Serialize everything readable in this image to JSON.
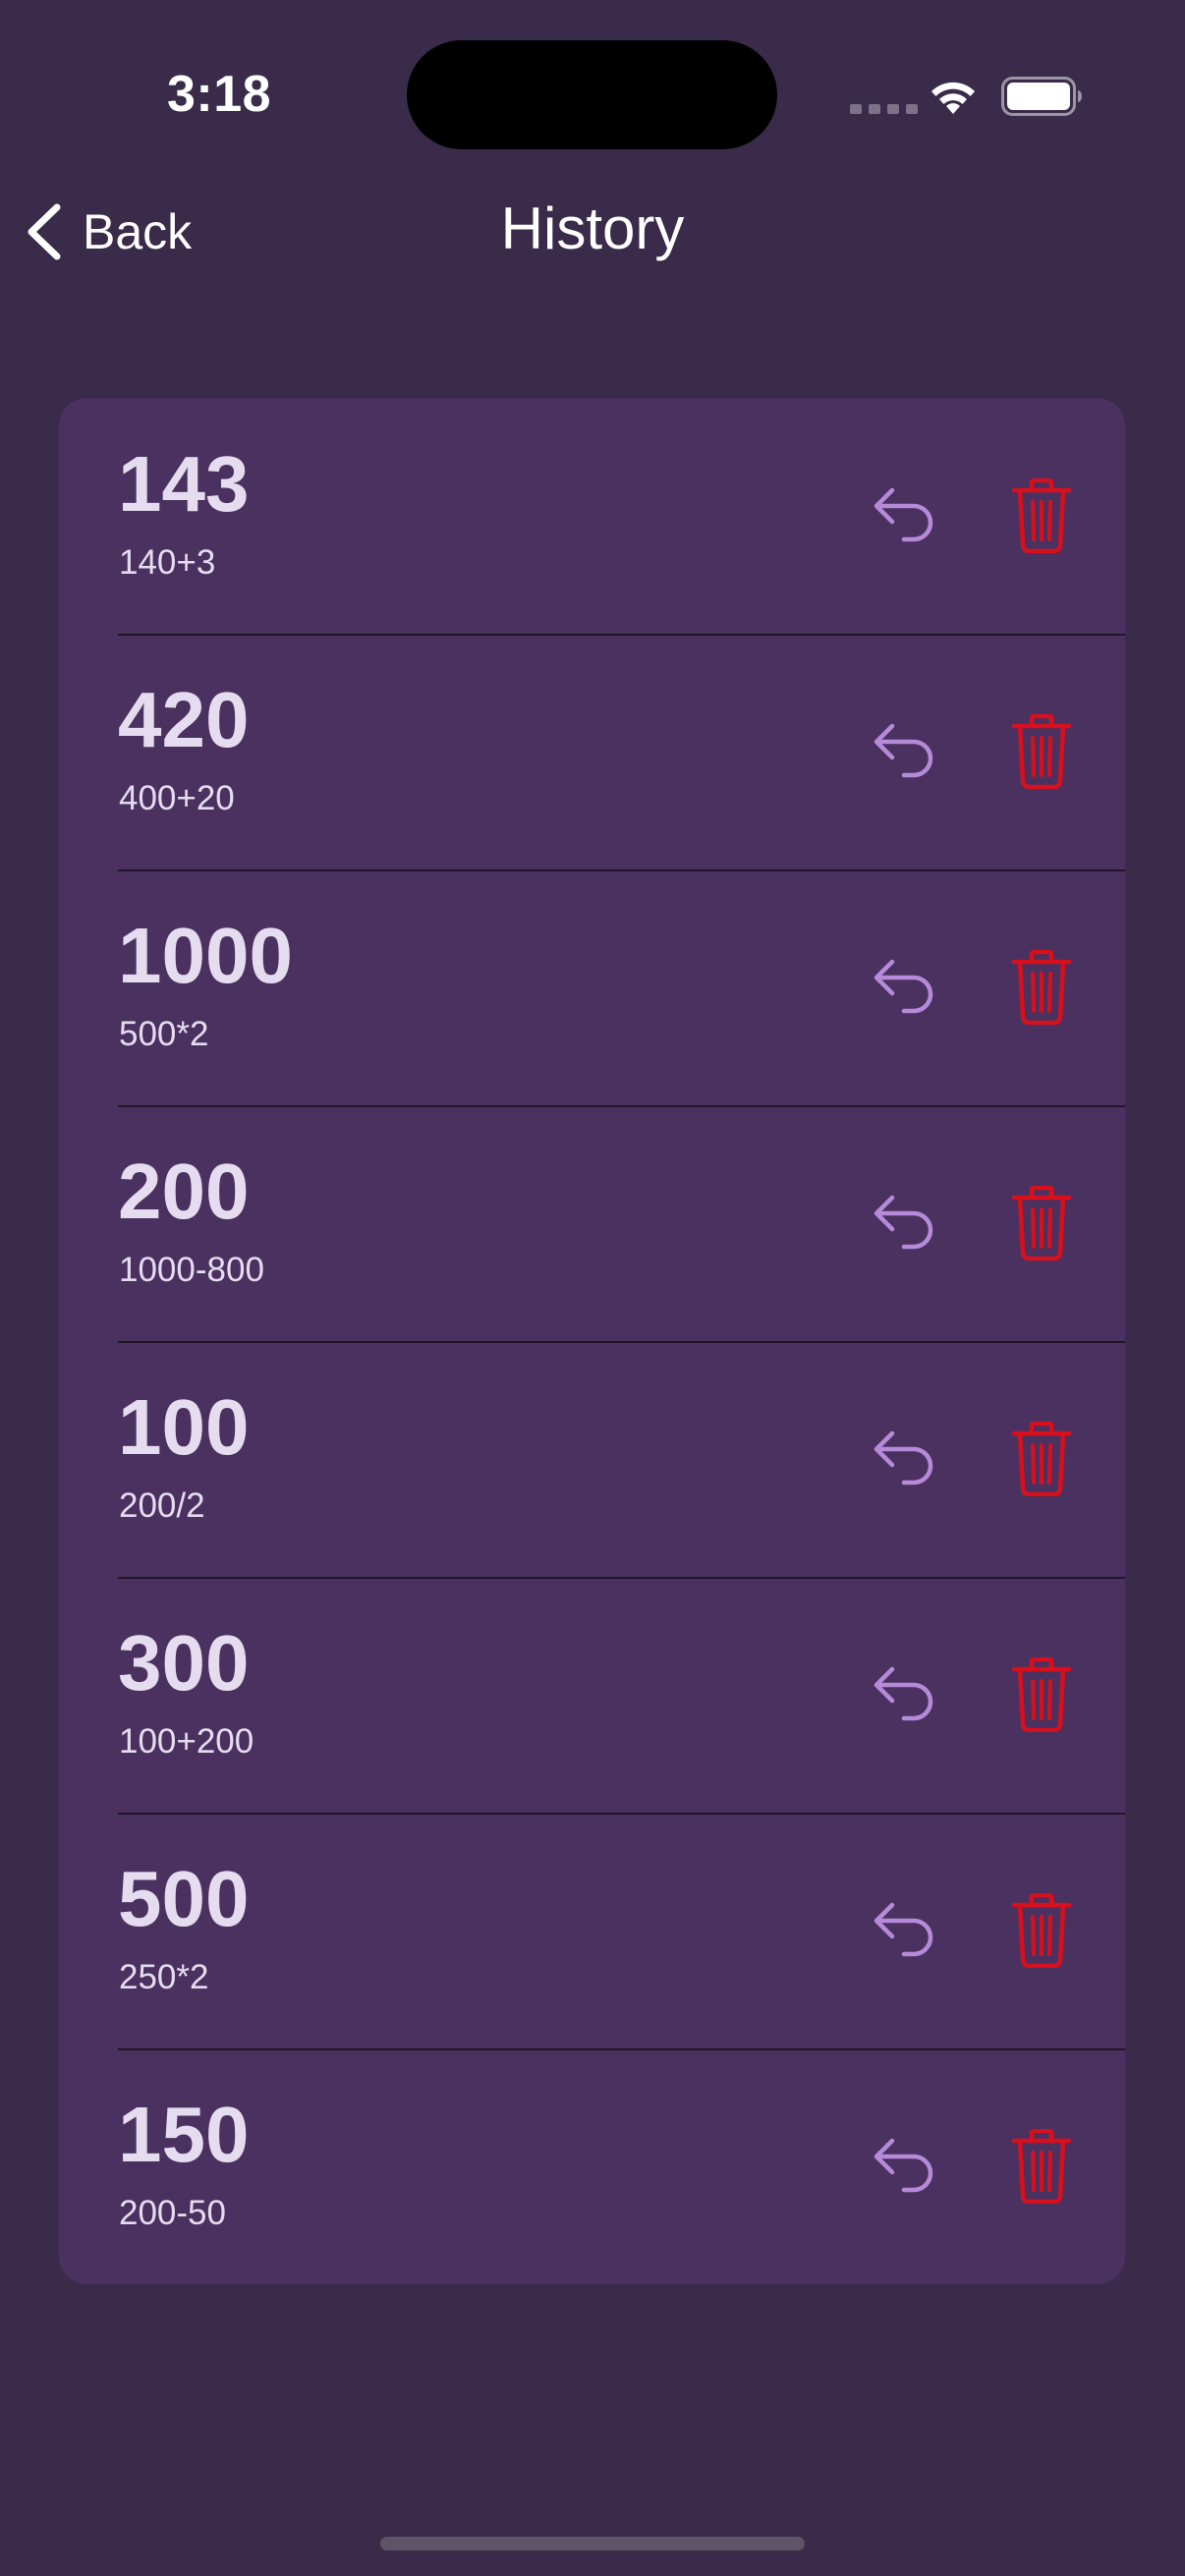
{
  "status_bar": {
    "time": "3:18"
  },
  "nav": {
    "back_label": "Back",
    "title": "History"
  },
  "colors": {
    "background": "#392b49",
    "card": "#4a315f",
    "restore_icon": "#b68ad8",
    "delete_icon": "#d8101d",
    "text": "#e6dcef"
  },
  "icons": {
    "back": "chevron-left-icon",
    "restore": "undo-arrow-icon",
    "delete": "trash-icon"
  },
  "history": {
    "items": [
      {
        "result": "143",
        "expression": "140+3"
      },
      {
        "result": "420",
        "expression": "400+20"
      },
      {
        "result": "1000",
        "expression": "500*2"
      },
      {
        "result": "200",
        "expression": "1000-800"
      },
      {
        "result": "100",
        "expression": "200/2"
      },
      {
        "result": "300",
        "expression": "100+200"
      },
      {
        "result": "500",
        "expression": "250*2"
      },
      {
        "result": "150",
        "expression": "200-50"
      }
    ]
  }
}
